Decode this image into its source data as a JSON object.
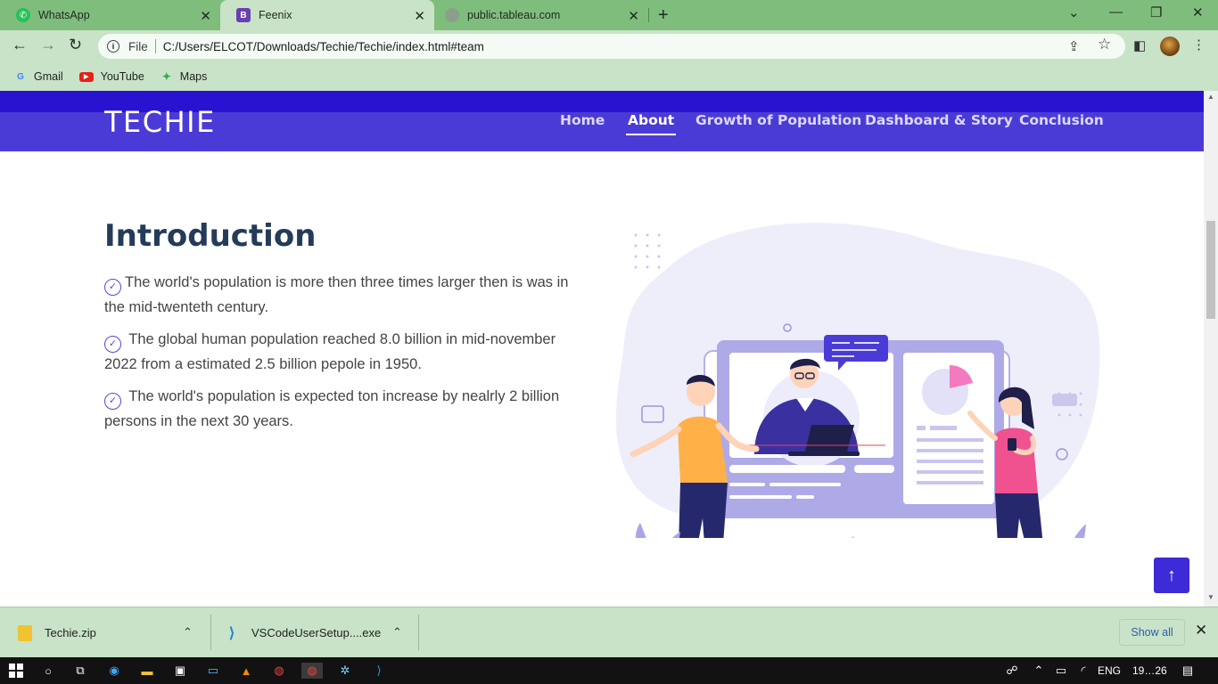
{
  "browser": {
    "tabs": [
      {
        "title": "WhatsApp",
        "icon": "whatsapp-icon"
      },
      {
        "title": "Feenix",
        "icon": "bootstrap-icon"
      },
      {
        "title": "public.tableau.com",
        "icon": "globe-icon"
      }
    ],
    "address": {
      "scheme": "File",
      "url": "C:/Users/ELCOT/Downloads/Techie/Techie/index.html#team"
    },
    "bookmarks": [
      "Gmail",
      "YouTube",
      "Maps"
    ]
  },
  "site": {
    "logo": "TECHIE",
    "nav": [
      "Home",
      "About",
      "Growth of Population",
      "Dashboard & Story",
      "Conclusion"
    ],
    "active_nav": "About"
  },
  "intro": {
    "title": "Introduction",
    "bullets": [
      "The world's population is more then three times larger then is was in the mid-twenteth century.",
      " The global human population reached 8.0 billion in mid-november 2022 from a estimated 2.5 billion pepole in 1950.",
      " The world's population is expected ton increase by nealrly 2 billion persons in the next 30 years."
    ]
  },
  "downloads": {
    "items": [
      "Techie.zip",
      "VSCodeUserSetup....exe"
    ],
    "show_all": "Show all"
  },
  "taskbar": {
    "language": "ENG",
    "time": "19…26"
  },
  "colors": {
    "accent": "#4b3bd6",
    "chrome": "#c8e3c7",
    "title": "#243b5a"
  }
}
